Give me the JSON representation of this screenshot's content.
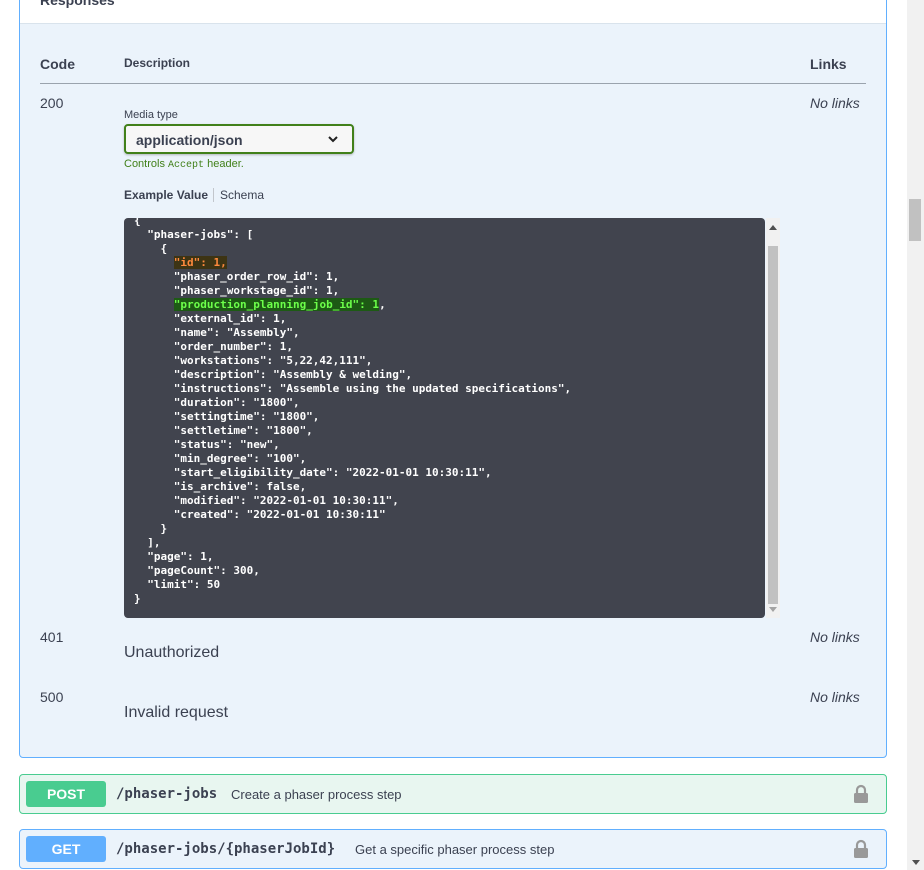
{
  "responses": {
    "section_title": "Responses",
    "headers": {
      "code": "Code",
      "description": "Description",
      "links": "Links"
    },
    "items": [
      {
        "code": "200",
        "links": "No links",
        "media_type_label": "Media type",
        "media_type_value": "application/json",
        "controls_prefix": "Controls ",
        "controls_code": "Accept",
        "controls_suffix": " header.",
        "tab_example": "Example Value",
        "tab_schema": "Schema"
      },
      {
        "code": "401",
        "description": "Unauthorized",
        "links": "No links"
      },
      {
        "code": "500",
        "description": "Invalid request",
        "links": "No links"
      }
    ]
  },
  "example_json": {
    "line_open": "{",
    "line_list_key": "  \"phaser-jobs\": [",
    "line_obj_open": "    {",
    "line_id_indent": "      ",
    "line_id": "\"id\": 1,",
    "line_order_row": "      \"phaser_order_row_id\": 1,",
    "line_workstage": "      \"phaser_workstage_id\": 1,",
    "line_ppj_indent": "      ",
    "line_ppj": "\"production_planning_job_id\": 1",
    "line_ppj_comma": ",",
    "line_external": "      \"external_id\": 1,",
    "line_name": "      \"name\": \"Assembly\",",
    "line_order_number": "      \"order_number\": 1,",
    "line_workstations": "      \"workstations\": \"5,22,42,111\",",
    "line_description": "      \"description\": \"Assembly & welding\",",
    "line_instructions": "      \"instructions\": \"Assemble using the updated specifications\",",
    "line_duration": "      \"duration\": \"1800\",",
    "line_settingtime": "      \"settingtime\": \"1800\",",
    "line_settletime": "      \"settletime\": \"1800\",",
    "line_status": "      \"status\": \"new\",",
    "line_min_degree": "      \"min_degree\": \"100\",",
    "line_start": "      \"start_eligibility_date\": \"2022-01-01 10:30:11\",",
    "line_archive": "      \"is_archive\": false,",
    "line_modified": "      \"modified\": \"2022-01-01 10:30:11\",",
    "line_created": "      \"created\": \"2022-01-01 10:30:11\"",
    "line_obj_close": "    }",
    "line_list_close": "  ],",
    "line_page": "  \"page\": 1,",
    "line_pagecount": "  \"pageCount\": 300,",
    "line_limit": "  \"limit\": 50",
    "line_close": "}"
  },
  "operations": [
    {
      "method": "POST",
      "path": "/phaser-jobs",
      "summary": "Create a phaser process step",
      "icon": "lock-icon"
    },
    {
      "method": "GET",
      "path": "/phaser-jobs/{phaserJobId}",
      "summary": "Get a specific phaser process step",
      "icon": "lock-icon"
    }
  ],
  "colors": {
    "get": "#61affe",
    "post": "#49cc90",
    "success_green": "#41801a",
    "code_bg": "#41444e"
  }
}
